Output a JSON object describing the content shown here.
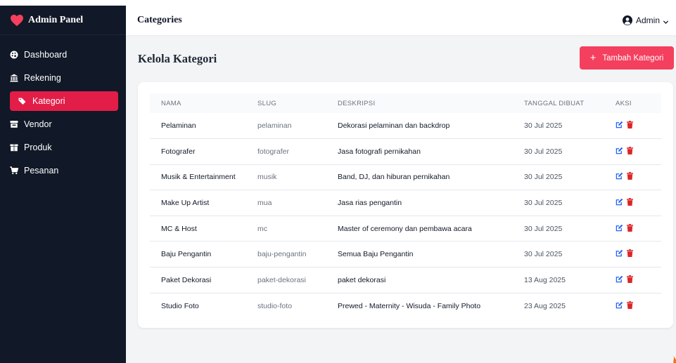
{
  "sidebar": {
    "brand": "Admin Panel",
    "items": [
      {
        "label": "Dashboard",
        "icon": "palette-icon",
        "active": false
      },
      {
        "label": "Rekening",
        "icon": "bank-icon",
        "active": false
      },
      {
        "label": "Kategori",
        "icon": "tags-icon",
        "active": true
      },
      {
        "label": "Vendor",
        "icon": "store-icon",
        "active": false
      },
      {
        "label": "Produk",
        "icon": "box-icon",
        "active": false
      },
      {
        "label": "Pesanan",
        "icon": "cart-icon",
        "active": false
      }
    ]
  },
  "header": {
    "title": "Categories",
    "user": "Admin"
  },
  "main": {
    "title": "Kelola Kategori",
    "add_button": "Tambah Kategori",
    "table": {
      "headers": [
        "NAMA",
        "SLUG",
        "DESKRIPSI",
        "TANGGAL DIBUAT",
        "AKSI"
      ],
      "rows": [
        {
          "nama": "Pelaminan",
          "slug": "pelaminan",
          "deskripsi": "Dekorasi pelaminan dan backdrop",
          "tanggal": "30 Jul 2025"
        },
        {
          "nama": "Fotografer",
          "slug": "fotografer",
          "deskripsi": "Jasa fotografi pernikahan",
          "tanggal": "30 Jul 2025"
        },
        {
          "nama": "Musik & Entertainment",
          "slug": "musik",
          "deskripsi": "Band, DJ, dan hiburan pernikahan",
          "tanggal": "30 Jul 2025"
        },
        {
          "nama": "Make Up Artist",
          "slug": "mua",
          "deskripsi": "Jasa rias pengantin",
          "tanggal": "30 Jul 2025"
        },
        {
          "nama": "MC & Host",
          "slug": "mc",
          "deskripsi": "Master of ceremony dan pembawa acara",
          "tanggal": "30 Jul 2025"
        },
        {
          "nama": "Baju Pengantin",
          "slug": "baju-pengantin",
          "deskripsi": "Semua Baju Pengantin",
          "tanggal": "30 Jul 2025"
        },
        {
          "nama": "Paket Dekorasi",
          "slug": "paket-dekorasi",
          "deskripsi": "paket dekorasi",
          "tanggal": "13 Aug 2025"
        },
        {
          "nama": "Studio Foto",
          "slug": "studio-foto",
          "deskripsi": "Prewed - Maternity - Wisuda - Family Photo",
          "tanggal": "23 Aug 2025"
        }
      ]
    }
  },
  "colors": {
    "sidebar_bg": "#111827",
    "accent": "#e11d48",
    "button": "#f43f5e",
    "edit_icon": "#2563eb",
    "delete_icon": "#dc2626"
  }
}
